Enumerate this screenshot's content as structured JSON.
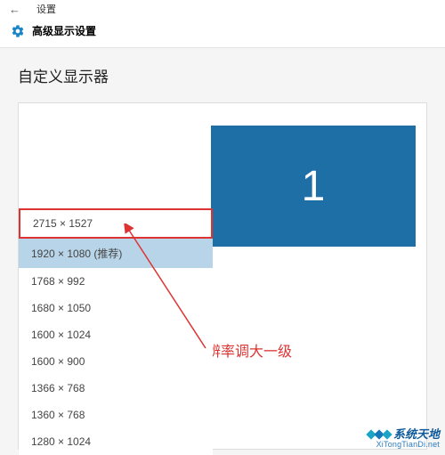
{
  "header": {
    "back_label": "←",
    "title": "设置"
  },
  "subheader": {
    "title": "高级显示设置"
  },
  "section": {
    "title": "自定义显示器"
  },
  "monitor": {
    "number": "1"
  },
  "resolution_list": {
    "items": [
      {
        "label": "2715 × 1527",
        "highlight": true,
        "selected": false
      },
      {
        "label": "1920 × 1080 (推荐)",
        "highlight": false,
        "selected": true
      },
      {
        "label": "1768 × 992",
        "highlight": false,
        "selected": false
      },
      {
        "label": "1680 × 1050",
        "highlight": false,
        "selected": false
      },
      {
        "label": "1600 × 1024",
        "highlight": false,
        "selected": false
      },
      {
        "label": "1600 × 900",
        "highlight": false,
        "selected": false
      },
      {
        "label": "1366 × 768",
        "highlight": false,
        "selected": false
      },
      {
        "label": "1360 × 768",
        "highlight": false,
        "selected": false
      },
      {
        "label": "1280 × 1024",
        "highlight": false,
        "selected": false
      }
    ]
  },
  "annotation": {
    "text": "分辨率调大一级",
    "color": "#d33"
  },
  "watermark": {
    "title": "系统天地",
    "subtitle": "XiTongTianDi.net"
  }
}
